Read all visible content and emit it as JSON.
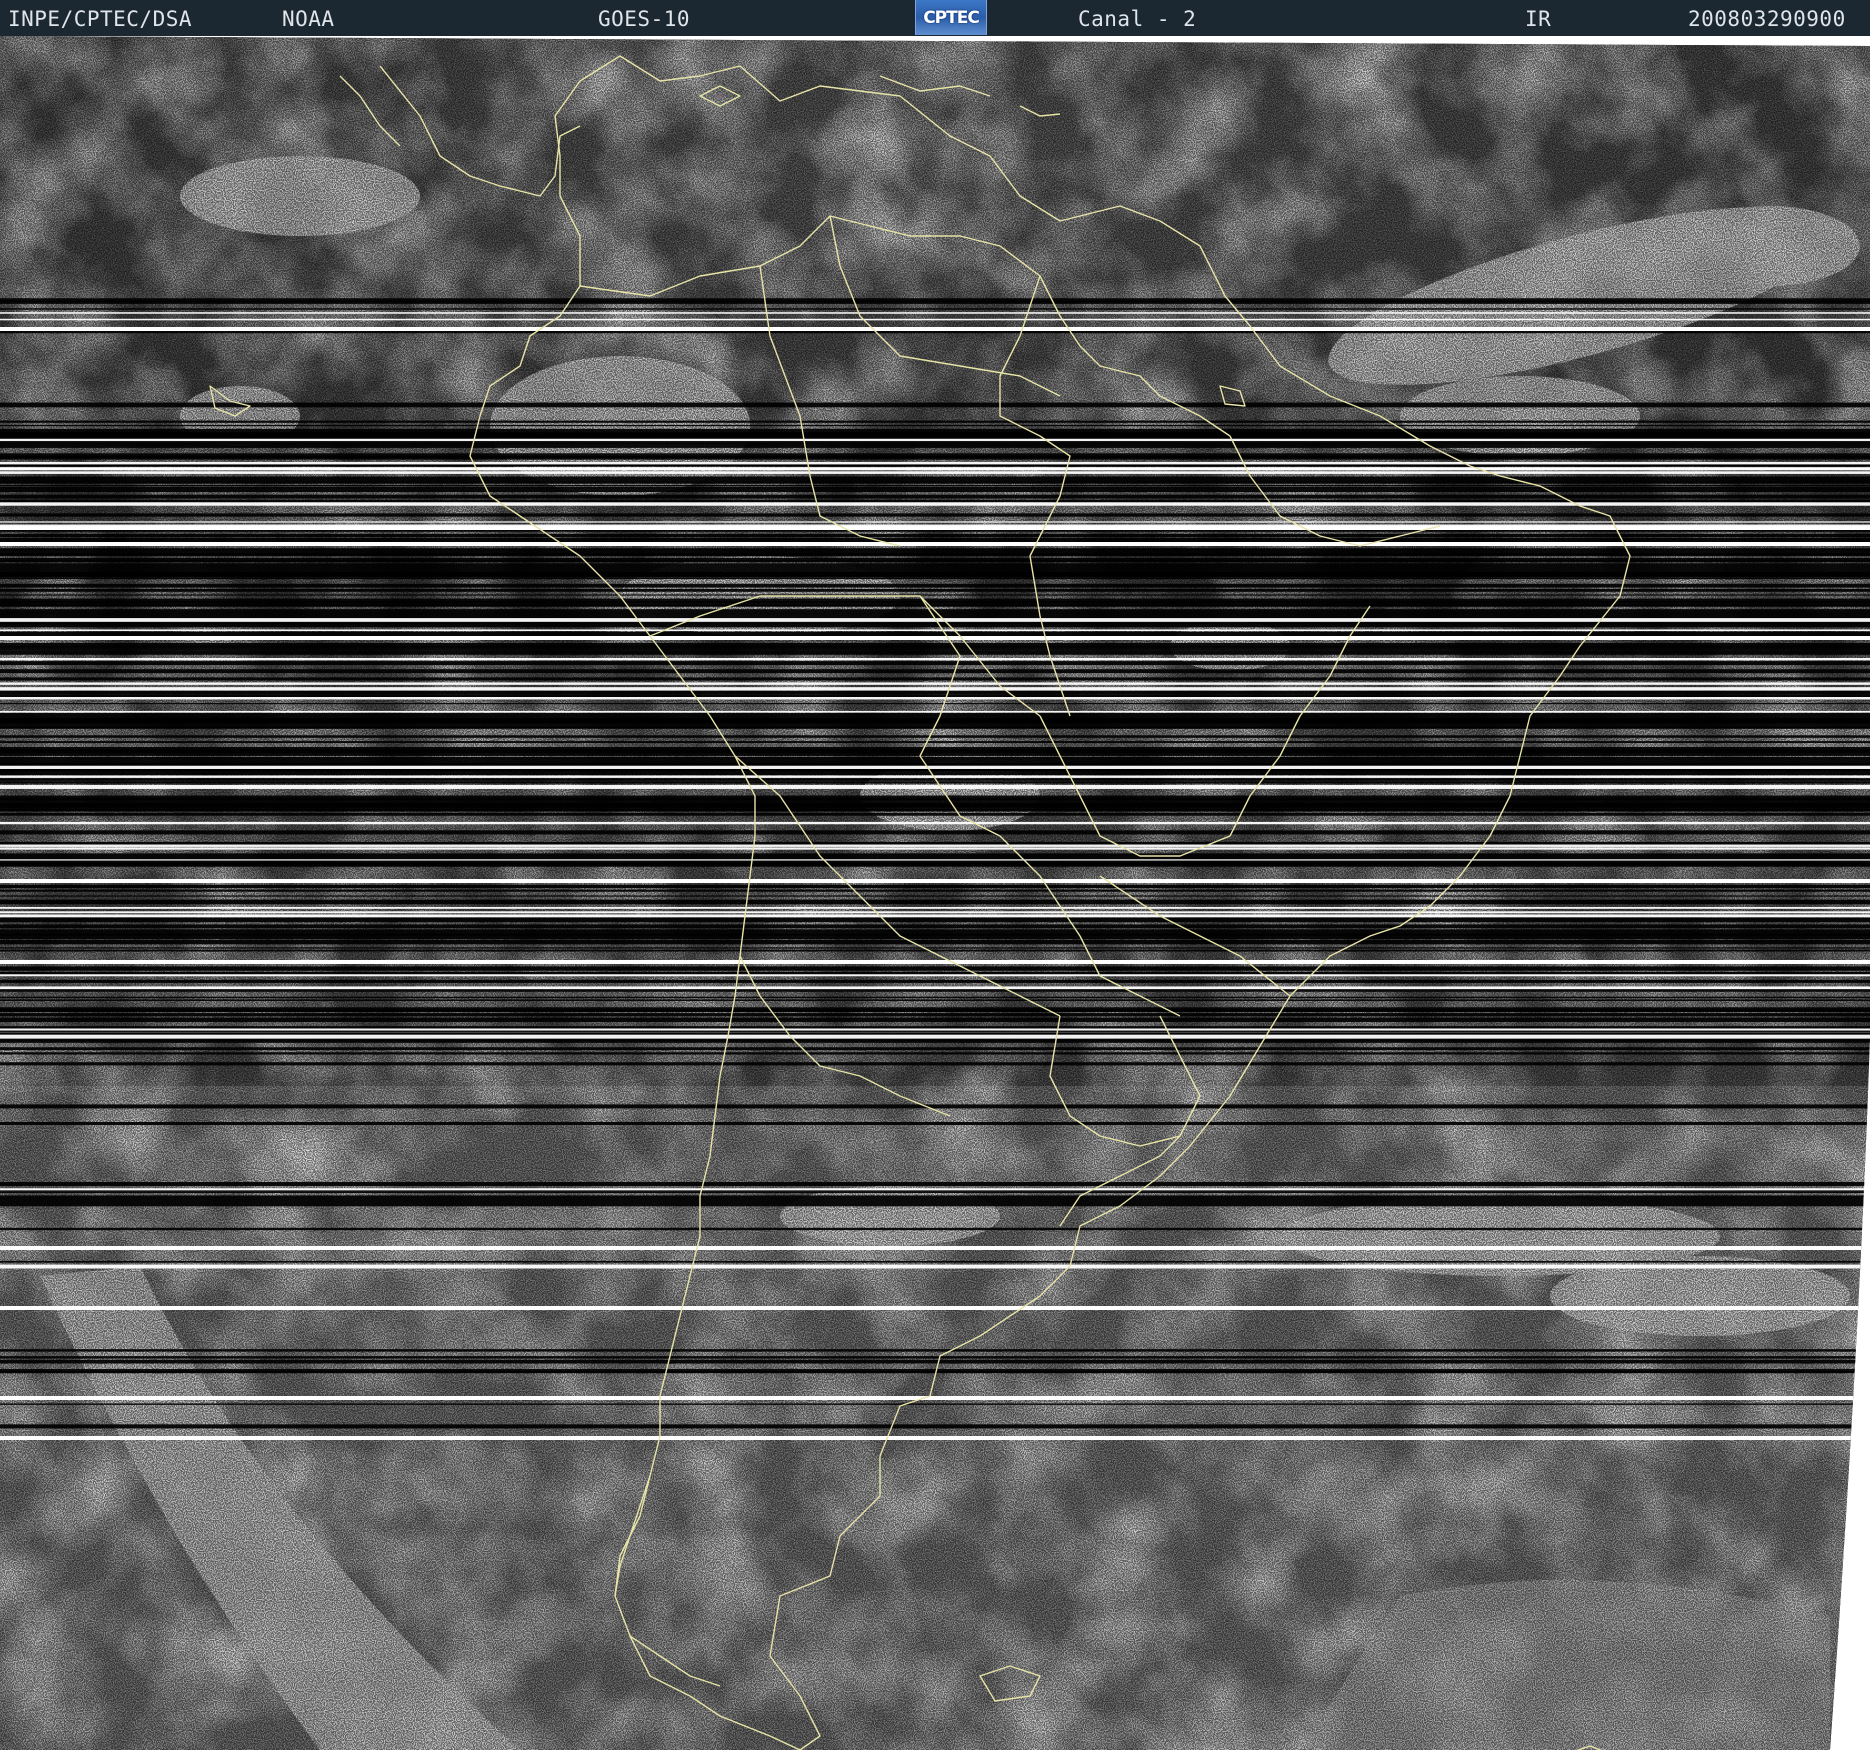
{
  "header": {
    "agency": "INPE/CPTEC/DSA",
    "provider": "NOAA",
    "satellite": "GOES-10",
    "logo_text": "CPTEC",
    "channel": "Canal - 2",
    "band": "IR",
    "timestamp": "200803290900"
  },
  "colors": {
    "header_bg": "#1b2731",
    "header_text": "#dfe5ea",
    "coastline": "#e8e4a8",
    "logo_bg": "#2b5da8"
  },
  "map": {
    "region": "South America",
    "imagery": "infrared",
    "overlay": "country-borders"
  }
}
